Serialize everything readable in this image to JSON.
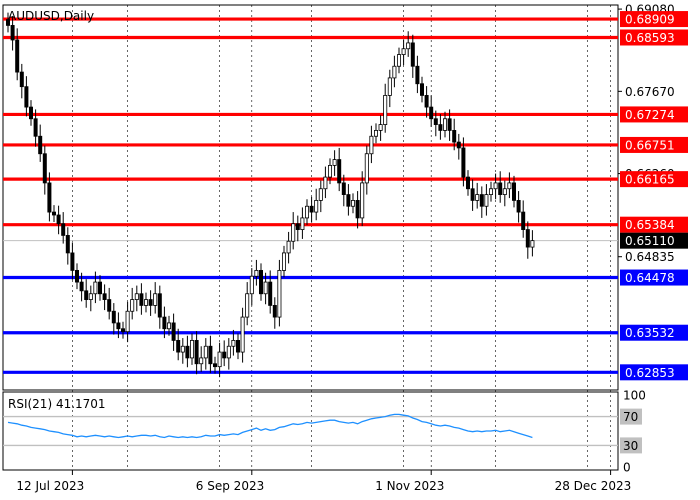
{
  "chart_data": {
    "type": "candlestick",
    "title": "AUDUSD,Daily",
    "price_axis": {
      "range": [
        0.6255,
        0.6915
      ],
      "ticks": [
        "0.69080",
        "0.67670",
        "0.66260",
        "0.64835"
      ]
    },
    "current_price": {
      "value": 0.6511,
      "label": "0.65110"
    },
    "resistance_levels": [
      {
        "value": 0.68909,
        "label": "0.68909",
        "color": "#ff0000"
      },
      {
        "value": 0.68593,
        "label": "0.68593",
        "color": "#ff0000"
      },
      {
        "value": 0.67274,
        "label": "0.67274",
        "color": "#ff0000"
      },
      {
        "value": 0.66751,
        "label": "0.66751",
        "color": "#ff0000"
      },
      {
        "value": 0.66165,
        "label": "0.66165",
        "color": "#ff0000"
      },
      {
        "value": 0.65384,
        "label": "0.65384",
        "color": "#ff0000"
      }
    ],
    "support_levels": [
      {
        "value": 0.64478,
        "label": "0.64478",
        "color": "#0000ff"
      },
      {
        "value": 0.63532,
        "label": "0.63532",
        "color": "#0000ff"
      },
      {
        "value": 0.62853,
        "label": "0.62853",
        "color": "#0000ff"
      }
    ],
    "date_labels": [
      "12 Jul 2023",
      "6 Sep 2023",
      "1 Nov 2023",
      "28 Dec 2023"
    ],
    "date_label_bars": [
      14,
      53,
      92,
      131
    ],
    "price_series": [
      0.688,
      0.6855,
      0.68,
      0.6775,
      0.674,
      0.672,
      0.669,
      0.666,
      0.661,
      0.656,
      0.6555,
      0.654,
      0.652,
      0.649,
      0.646,
      0.644,
      0.6425,
      0.641,
      0.642,
      0.644,
      0.642,
      0.641,
      0.639,
      0.637,
      0.636,
      0.6355,
      0.639,
      0.641,
      0.642,
      0.64,
      0.641,
      0.64,
      0.642,
      0.638,
      0.636,
      0.637,
      0.634,
      0.632,
      0.633,
      0.631,
      0.634,
      0.63,
      0.631,
      0.633,
      0.63,
      0.6295,
      0.632,
      0.631,
      0.633,
      0.634,
      0.632,
      0.638,
      0.642,
      0.645,
      0.646,
      0.642,
      0.644,
      0.64,
      0.638,
      0.646,
      0.649,
      0.651,
      0.654,
      0.653,
      0.655,
      0.657,
      0.656,
      0.658,
      0.66,
      0.662,
      0.664,
      0.665,
      0.661,
      0.659,
      0.657,
      0.658,
      0.655,
      0.661,
      0.666,
      0.669,
      0.67,
      0.671,
      0.676,
      0.679,
      0.681,
      0.683,
      0.684,
      0.685,
      0.681,
      0.678,
      0.676,
      0.674,
      0.672,
      0.671,
      0.67,
      0.672,
      0.67,
      0.668,
      0.667,
      0.662,
      0.66,
      0.658,
      0.659,
      0.657,
      0.659,
      0.66,
      0.661,
      0.659,
      0.66,
      0.661,
      0.658,
      0.656,
      0.653,
      0.65,
      0.6511
    ],
    "rsi": {
      "label": "RSI(21) 41.1701",
      "range": [
        0,
        100
      ],
      "levels": [
        70,
        30
      ],
      "ticks": [
        "100",
        "70",
        "30",
        "0"
      ],
      "color": "#1e90ff",
      "values": [
        62,
        61,
        60,
        58,
        57,
        55,
        54,
        53,
        52,
        50,
        49,
        48,
        46,
        45,
        44,
        42,
        43,
        42,
        43,
        44,
        43,
        42,
        43,
        42,
        41,
        42,
        43,
        42,
        43,
        44,
        44,
        43,
        44,
        42,
        41,
        43,
        42,
        41,
        42,
        41,
        42,
        41,
        42,
        44,
        43,
        43,
        45,
        44,
        45,
        46,
        45,
        48,
        50,
        52,
        54,
        51,
        53,
        51,
        52,
        55,
        56,
        58,
        60,
        59,
        60,
        62,
        61,
        62,
        63,
        64,
        65,
        65,
        63,
        62,
        61,
        62,
        60,
        63,
        65,
        67,
        68,
        69,
        70,
        72,
        73,
        73,
        72,
        71,
        68,
        66,
        63,
        62,
        60,
        58,
        57,
        58,
        57,
        55,
        54,
        52,
        50,
        49,
        50,
        49,
        50,
        50,
        51,
        49,
        50,
        51,
        49,
        47,
        45,
        43,
        41
      ]
    }
  }
}
